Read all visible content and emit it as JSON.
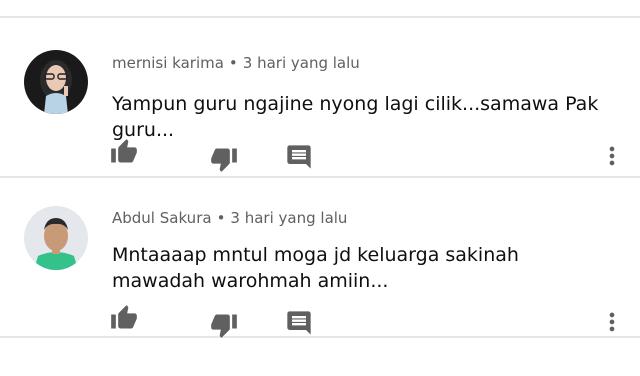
{
  "comments": [
    {
      "author": "mernisi karima",
      "separator": "•",
      "time": "3 hari yang lalu",
      "text": "Yampun guru ngajine nyong lagi cilik...samawa Pak guru...",
      "avatar": "girl-with-glasses-photo"
    },
    {
      "author": "Abdul Sakura",
      "separator": "•",
      "time": "3 hari yang lalu",
      "text": "Mntaaaap mntul moga jd keluarga sakinah mawadah warohmah amiin...",
      "avatar": "young-man-photo"
    }
  ],
  "icons": {
    "like": "thumb-up-icon",
    "dislike": "thumb-down-icon",
    "reply": "comment-icon",
    "menu": "more-vert-icon"
  },
  "colors": {
    "icon": "#606060",
    "divider": "#e6e6e6",
    "meta": "#606060",
    "text": "#0f0f0f"
  }
}
